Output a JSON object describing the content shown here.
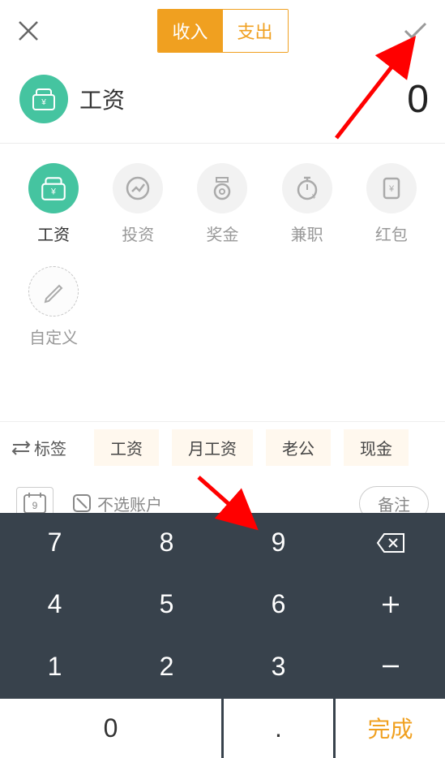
{
  "header": {
    "tabs": {
      "income": "收入",
      "expense": "支出"
    },
    "selected_tab": "income"
  },
  "current_category": {
    "name": "工资"
  },
  "amount": "0",
  "categories": [
    {
      "key": "salary",
      "label": "工资",
      "selected": true
    },
    {
      "key": "invest",
      "label": "投资",
      "selected": false
    },
    {
      "key": "bonus",
      "label": "奖金",
      "selected": false
    },
    {
      "key": "parttime",
      "label": "兼职",
      "selected": false
    },
    {
      "key": "hongbao",
      "label": "红包",
      "selected": false
    },
    {
      "key": "custom",
      "label": "自定义",
      "selected": false
    }
  ],
  "tags": {
    "lead": "标签",
    "items": [
      "工资",
      "月工资",
      "老公",
      "现金"
    ]
  },
  "account_row": {
    "date_day": "9",
    "account_label": "不选账户",
    "memo_label": "备注"
  },
  "keypad": {
    "k7": "7",
    "k8": "8",
    "k9": "9",
    "k4": "4",
    "k5": "5",
    "k6": "6",
    "k1": "1",
    "k2": "2",
    "k3": "3",
    "k0": "0",
    "kdot": ".",
    "done": "完成"
  }
}
